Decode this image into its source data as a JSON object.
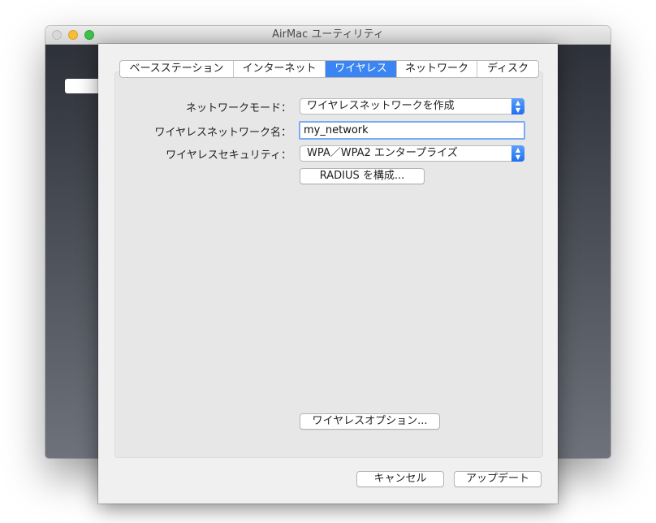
{
  "window": {
    "title": "AirMac ユーティリティ"
  },
  "tabs": [
    {
      "label": "ベースステーション"
    },
    {
      "label": "インターネット"
    },
    {
      "label": "ワイヤレス",
      "active": true
    },
    {
      "label": "ネットワーク"
    },
    {
      "label": "ディスク"
    }
  ],
  "form": {
    "mode_label": "ネットワークモード：",
    "mode_value": "ワイヤレスネットワークを作成",
    "name_label": "ワイヤレスネットワーク名：",
    "name_value": "my_network",
    "security_label": "ワイヤレスセキュリティ：",
    "security_value": "WPA／WPA2 エンタープライズ",
    "radius_button": "RADIUS を構成...",
    "options_button": "ワイヤレスオプション..."
  },
  "footer": {
    "cancel_label": "キャンセル",
    "update_label": "アップデート"
  },
  "colors": {
    "accent": "#3b85f3",
    "focus_ring": "#7aacf2",
    "close_light": "#d8d8d8",
    "minimize_light": "#f6bd36",
    "maximize_light": "#3dc24a"
  },
  "icons": {
    "popup_arrows": "updown-chevron-icon"
  }
}
